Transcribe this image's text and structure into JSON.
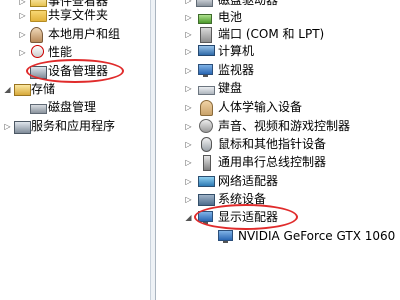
{
  "left_tree": {
    "items": [
      {
        "label": "事件查看器",
        "expander": "▷",
        "icon": "event-viewer-icon"
      },
      {
        "label": "共享文件夹",
        "expander": "▷",
        "icon": "shared-folders-icon"
      },
      {
        "label": "本地用户和组",
        "expander": "▷",
        "icon": "local-users-icon"
      },
      {
        "label": "性能",
        "expander": "▷",
        "icon": "performance-icon"
      },
      {
        "label": "设备管理器",
        "expander": "",
        "icon": "device-manager-icon",
        "highlighted": true
      },
      {
        "label": "存储",
        "expander": "◢",
        "icon": "storage-icon"
      },
      {
        "label": "磁盘管理",
        "expander": "",
        "icon": "disk-management-icon"
      },
      {
        "label": "服务和应用程序",
        "expander": "▷",
        "icon": "services-apps-icon"
      }
    ]
  },
  "device_tree": {
    "items": [
      {
        "label": "磁盘驱动器",
        "expander": "▷",
        "icon": "disk-drive-icon"
      },
      {
        "label": "电池",
        "expander": "▷",
        "icon": "battery-icon"
      },
      {
        "label": "端口 (COM 和 LPT)",
        "expander": "▷",
        "icon": "port-icon"
      },
      {
        "label": "计算机",
        "expander": "▷",
        "icon": "computer-icon"
      },
      {
        "label": "监视器",
        "expander": "▷",
        "icon": "monitor-icon"
      },
      {
        "label": "键盘",
        "expander": "▷",
        "icon": "keyboard-icon"
      },
      {
        "label": "人体学输入设备",
        "expander": "▷",
        "icon": "hid-icon"
      },
      {
        "label": "声音、视频和游戏控制器",
        "expander": "▷",
        "icon": "sound-icon"
      },
      {
        "label": "鼠标和其他指针设备",
        "expander": "▷",
        "icon": "mouse-icon"
      },
      {
        "label": "通用串行总线控制器",
        "expander": "▷",
        "icon": "usb-icon"
      },
      {
        "label": "网络适配器",
        "expander": "▷",
        "icon": "network-adapter-icon"
      },
      {
        "label": "系统设备",
        "expander": "▷",
        "icon": "system-devices-icon"
      },
      {
        "label": "显示适配器",
        "expander": "◢",
        "icon": "display-adapter-icon",
        "highlighted": true
      }
    ],
    "child": {
      "label": "NVIDIA GeForce GTX 1060",
      "icon": "gpu-icon"
    }
  },
  "colors": {
    "highlight_ring": "#e02b2b",
    "splitter": "#dfe6ee"
  }
}
